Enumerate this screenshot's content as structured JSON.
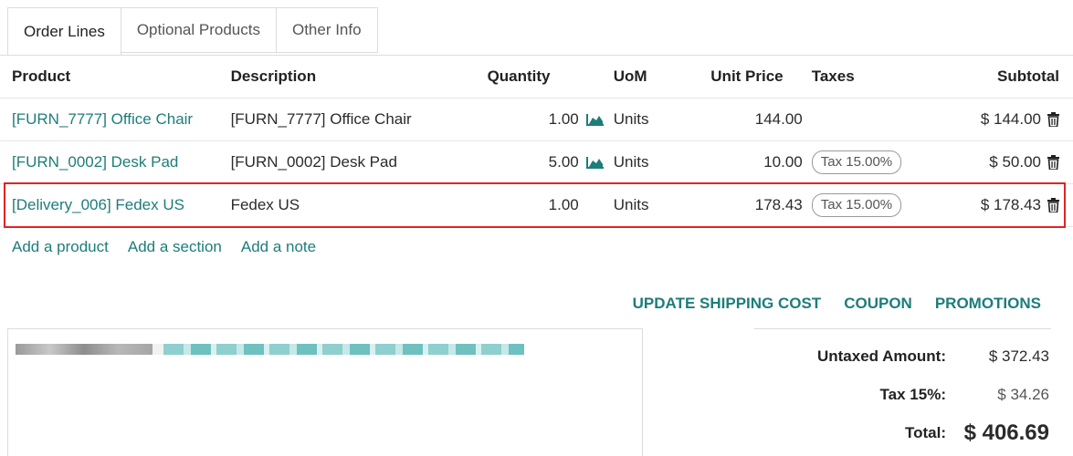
{
  "tabs": [
    "Order Lines",
    "Optional Products",
    "Other Info"
  ],
  "columns": {
    "product": "Product",
    "description": "Description",
    "quantity": "Quantity",
    "uom": "UoM",
    "unit_price": "Unit Price",
    "taxes": "Taxes",
    "subtotal": "Subtotal"
  },
  "lines": [
    {
      "product": "[FURN_7777] Office Chair",
      "description": "[FURN_7777] Office Chair",
      "quantity": "1.00",
      "uom": "Units",
      "unit_price": "144.00",
      "tax": "",
      "subtotal": "$ 144.00",
      "has_forecast": true
    },
    {
      "product": "[FURN_0002] Desk Pad",
      "description": "[FURN_0002] Desk Pad",
      "quantity": "5.00",
      "uom": "Units",
      "unit_price": "10.00",
      "tax": "Tax 15.00%",
      "subtotal": "$ 50.00",
      "has_forecast": true
    },
    {
      "product": "[Delivery_006] Fedex US",
      "description": "Fedex US",
      "quantity": "1.00",
      "uom": "Units",
      "unit_price": "178.43",
      "tax": "Tax 15.00%",
      "subtotal": "$ 178.43",
      "has_forecast": false
    }
  ],
  "add_links": {
    "product": "Add a product",
    "section": "Add a section",
    "note": "Add a note"
  },
  "actions": {
    "shipping": "UPDATE SHIPPING COST",
    "coupon": "COUPON",
    "promotions": "PROMOTIONS"
  },
  "totals": {
    "untaxed_label": "Untaxed Amount:",
    "untaxed_value": "$ 372.43",
    "tax_label": "Tax 15%:",
    "tax_value": "$ 34.26",
    "total_label": "Total:",
    "total_value": "$ 406.69"
  },
  "colors": {
    "link": "#1d7d7a",
    "highlight": "#e02424",
    "forecast_icon": "#1d7d7a"
  },
  "icons": {
    "forecast": "area-chart-icon",
    "delete": "trash-icon"
  }
}
